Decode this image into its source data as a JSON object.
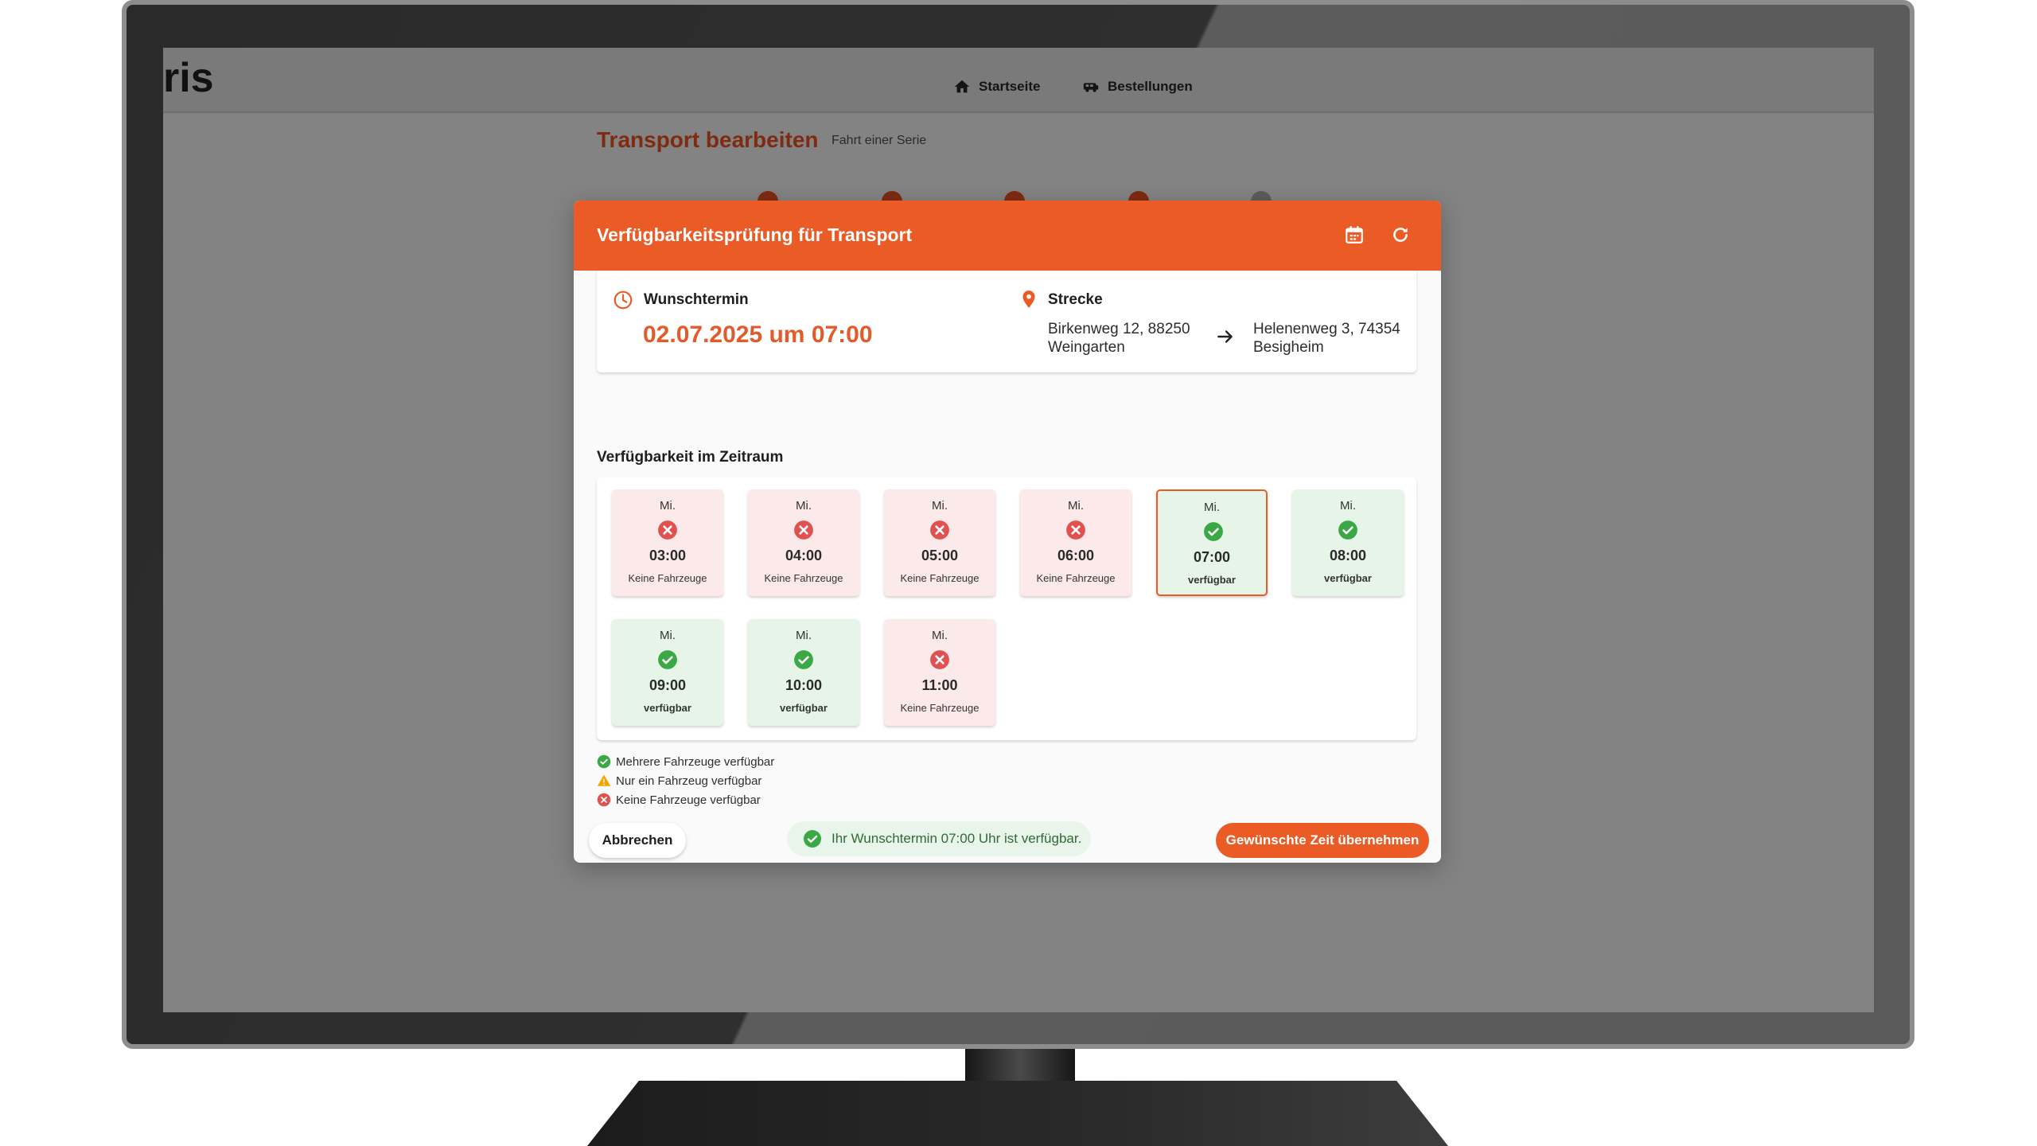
{
  "app": {
    "logo_text": "ris",
    "nav": [
      {
        "label": "Startseite",
        "icon": "home-icon"
      },
      {
        "label": "Bestellungen",
        "icon": "vehicle-icon"
      }
    ],
    "page_title": "Transport bearbeiten",
    "page_subtitle": "Fahrt einer Serie"
  },
  "modal": {
    "title": "Verfügbarkeitsprüfung für Transport",
    "wunschtermin_label": "Wunschtermin",
    "wunschtermin_value": "02.07.2025 um 07:00",
    "strecke_label": "Strecke",
    "from_line1": "Birkenweg 12, 88250",
    "from_line2": "Weingarten",
    "to_line1": "Helenenweg 3, 74354",
    "to_line2": "Besigheim",
    "section_label": "Verfügbarkeit im Zeitraum",
    "slots": [
      {
        "day": "Mi.",
        "time": "03:00",
        "status": "Keine Fahrzeuge",
        "available": false
      },
      {
        "day": "Mi.",
        "time": "04:00",
        "status": "Keine Fahrzeuge",
        "available": false
      },
      {
        "day": "Mi.",
        "time": "05:00",
        "status": "Keine Fahrzeuge",
        "available": false
      },
      {
        "day": "Mi.",
        "time": "06:00",
        "status": "Keine Fahrzeuge",
        "available": false
      },
      {
        "day": "Mi.",
        "time": "07:00",
        "status": "verfügbar",
        "available": true,
        "selected": true
      },
      {
        "day": "Mi.",
        "time": "08:00",
        "status": "verfügbar",
        "available": true
      },
      {
        "day": "Mi.",
        "time": "09:00",
        "status": "verfügbar",
        "available": true
      },
      {
        "day": "Mi.",
        "time": "10:00",
        "status": "verfügbar",
        "available": true
      },
      {
        "day": "Mi.",
        "time": "11:00",
        "status": "Keine Fahrzeuge",
        "available": false
      }
    ],
    "legend": [
      {
        "label": "Mehrere Fahrzeuge verfügbar",
        "icon": "check-circle-icon"
      },
      {
        "label": "Nur ein Fahrzeug verfügbar",
        "icon": "warning-icon"
      },
      {
        "label": "Keine Fahrzeuge verfügbar",
        "icon": "error-circle-icon"
      }
    ],
    "cancel_label": "Abbrechen",
    "info_message": "Ihr Wunschtermin 07:00 Uhr ist verfügbar.",
    "accept_label": "Gewünschte Zeit übernehmen"
  },
  "colors": {
    "accent": "#ea5b26",
    "available": "#3aa845",
    "unavailable": "#e05252",
    "warning": "#f0a500"
  }
}
